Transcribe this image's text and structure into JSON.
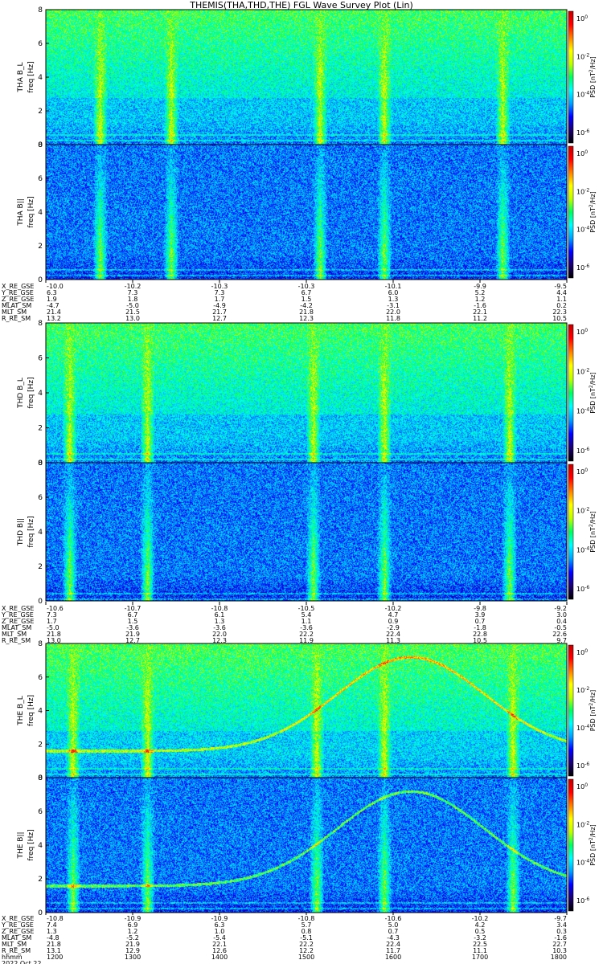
{
  "title": "THEMIS(THA,THD,THE) FGL Wave Survey Plot (Lin)",
  "colors": {
    "background": "#ffffff",
    "text": "#000000"
  },
  "chart_data": {
    "type": "heatmap",
    "colorbar": {
      "label": "PSD [nT²/Hz]",
      "label_main": "PSD [nT",
      "label_sup": "2",
      "label_tail": "/Hz]",
      "tick_mantissa": "10",
      "ticks": [
        "0",
        "-2",
        "-4",
        "-6"
      ],
      "colormap": [
        "#000000",
        "#1a0070",
        "#0000ff",
        "#00a0ff",
        "#00ffff",
        "#00ff60",
        "#c0ff00",
        "#ffff00",
        "#ff8000",
        "#ff0000",
        "#c00000"
      ]
    },
    "y_ticks": [
      "0",
      "2",
      "4",
      "6",
      "8"
    ],
    "ylim": [
      0,
      8
    ],
    "panels": [
      {
        "probe": "THA",
        "label": "THA B_L",
        "ylabel": "freq [Hz]",
        "bursts": [
          16,
          37,
          81,
          100,
          135
        ],
        "base_db": -5.3,
        "chorus": false
      },
      {
        "probe": "THA",
        "label": "THA B||",
        "ylabel": "freq [Hz]",
        "bursts": [
          16,
          37,
          81,
          100,
          135
        ],
        "base_db": -6.0,
        "chorus": false
      },
      {
        "probe": "THD",
        "label": "THD B_L",
        "ylabel": "freq [Hz]",
        "bursts": [
          7,
          30,
          79,
          100,
          137
        ],
        "base_db": -5.3,
        "chorus": false
      },
      {
        "probe": "THD",
        "label": "THD B||",
        "ylabel": "freq [Hz]",
        "bursts": [
          7,
          30,
          79,
          100,
          137
        ],
        "base_db": -6.0,
        "chorus": false
      },
      {
        "probe": "THE",
        "label": "THE B_L",
        "ylabel": "freq [Hz]",
        "bursts": [
          8,
          30,
          80,
          100,
          138
        ],
        "base_db": -5.2,
        "chorus": true
      },
      {
        "probe": "THE",
        "label": "THE B||",
        "ylabel": "freq [Hz]",
        "bursts": [
          8,
          30,
          80,
          100,
          138
        ],
        "base_db": -6.0,
        "chorus": true
      }
    ],
    "ephemeris": [
      {
        "probe": "THA",
        "rows": [
          {
            "label": "X_RE_GSE",
            "values": [
              "-10.0",
              "-10.2",
              "-10.3",
              "-10.3",
              "-10.1",
              "-9.9",
              "-9.5"
            ]
          },
          {
            "label": "Y_RE_GSE",
            "values": [
              "6.3",
              "7.3",
              "7.3",
              "6.7",
              "6.0",
              "5.2",
              "4.4"
            ]
          },
          {
            "label": "Z_RE_GSE",
            "values": [
              "1.9",
              "1.8",
              "1.7",
              "1.5",
              "1.3",
              "1.2",
              "1.1"
            ]
          },
          {
            "label": "MLAT_SM",
            "values": [
              "-4.7",
              "-5.0",
              "-4.9",
              "-4.2",
              "-3.1",
              "-1.6",
              "0.2"
            ]
          },
          {
            "label": "MLT_SM",
            "values": [
              "21.4",
              "21.5",
              "21.7",
              "21.8",
              "22.0",
              "22.1",
              "22.3"
            ]
          },
          {
            "label": "R_RE_SM",
            "values": [
              "13.2",
              "13.0",
              "12.7",
              "12.3",
              "11.8",
              "11.2",
              "10.5"
            ]
          }
        ]
      },
      {
        "probe": "THD",
        "rows": [
          {
            "label": "X_RE_GSE",
            "values": [
              "-10.6",
              "-10.7",
              "-10.8",
              "-10.5",
              "-10.2",
              "-9.8",
              "-9.2"
            ]
          },
          {
            "label": "Y_RE_GSE",
            "values": [
              "7.3",
              "6.7",
              "6.1",
              "5.4",
              "4.7",
              "3.9",
              "3.0"
            ]
          },
          {
            "label": "Z_RE_GSE",
            "values": [
              "1.7",
              "1.5",
              "1.3",
              "1.1",
              "0.9",
              "0.7",
              "0.4"
            ]
          },
          {
            "label": "MLAT_SM",
            "values": [
              "-5.0",
              "-3.6",
              "-3.6",
              "-3.6",
              "-2.9",
              "-1.8",
              "-0.5"
            ]
          },
          {
            "label": "MLT_SM",
            "values": [
              "21.8",
              "21.9",
              "22.0",
              "22.2",
              "22.4",
              "22.8",
              "22.6"
            ]
          },
          {
            "label": "R_RE_SM",
            "values": [
              "13.0",
              "12.7",
              "12.3",
              "11.9",
              "11.3",
              "10.5",
              "9.7"
            ]
          }
        ]
      },
      {
        "probe": "THE",
        "rows": [
          {
            "label": "X_RE_GSE",
            "values": [
              "-10.8",
              "-10.9",
              "-10.9",
              "-10.8",
              "-10.6",
              "-10.2",
              "-9.7"
            ]
          },
          {
            "label": "Y_RE_GSE",
            "values": [
              "7.4",
              "6.9",
              "6.3",
              "5.7",
              "5.0",
              "4.2",
              "3.4"
            ]
          },
          {
            "label": "Z_RE_GSE",
            "values": [
              "1.3",
              "1.2",
              "1.0",
              "0.8",
              "0.7",
              "0.5",
              "0.3"
            ]
          },
          {
            "label": "MLAT_SM",
            "values": [
              "-4.8",
              "-5.2",
              "-5.4",
              "-5.1",
              "-4.3",
              "-3.2",
              "-1.6"
            ]
          },
          {
            "label": "MLT_SM",
            "values": [
              "21.8",
              "21.9",
              "22.1",
              "22.2",
              "22.4",
              "22.5",
              "22.7"
            ]
          },
          {
            "label": "R_RE_SM",
            "values": [
              "13.1",
              "12.9",
              "12.6",
              "12.2",
              "11.7",
              "11.1",
              "10.3"
            ]
          },
          {
            "label": "hhmm",
            "values": [
              "1200",
              "1300",
              "1400",
              "1500",
              "1600",
              "1700",
              "1800"
            ]
          }
        ],
        "date": "2022 Oct 22"
      }
    ]
  }
}
